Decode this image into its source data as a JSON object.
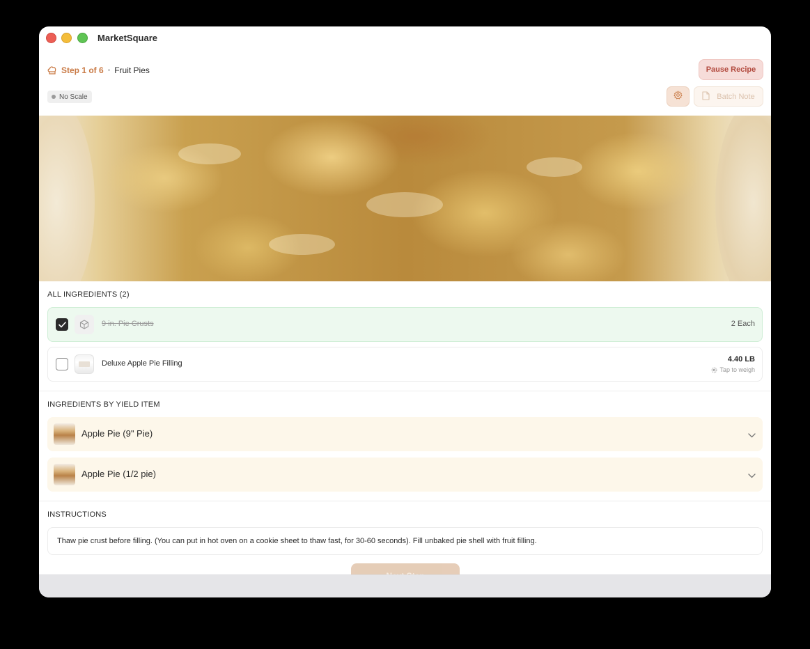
{
  "app": {
    "title": "MarketSquare"
  },
  "header": {
    "step_label": "Step 1 of 6",
    "separator": "•",
    "category": "Fruit Pies",
    "pause_label": "Pause Recipe",
    "scale_badge": "No Scale",
    "batch_note_label": "Batch Note"
  },
  "all_ingredients": {
    "heading": "ALL INGREDIENTS (2)",
    "items": [
      {
        "name": "9 in. Pie Crusts",
        "quantity": "2 Each",
        "checked": true
      },
      {
        "name": "Deluxe Apple Pie Filling",
        "quantity": "4.40 LB",
        "hint": "Tap to weigh",
        "checked": false
      }
    ]
  },
  "yield_items": {
    "heading": "INGREDIENTS BY YIELD ITEM",
    "items": [
      {
        "name": "Apple Pie (9\" Pie)"
      },
      {
        "name": "Apple Pie (1/2 pie)"
      }
    ]
  },
  "instructions": {
    "heading": "INSTRUCTIONS",
    "text": "Thaw pie crust before filling. (You can put in hot oven on a cookie sheet to thaw fast, for 30-60 seconds). Fill unbaked pie shell with fruit filling."
  },
  "footer": {
    "next_label": "Next Step"
  },
  "colors": {
    "accent": "#c97a45",
    "pause_bg": "#f6dcd9",
    "checked_row_bg": "#edf9ef",
    "yield_row_bg": "#fdf7ea"
  },
  "icons": [
    "chef-hat-icon",
    "gear-icon",
    "note-icon",
    "check-icon",
    "box-icon",
    "scale-icon",
    "chevron-down-icon"
  ]
}
